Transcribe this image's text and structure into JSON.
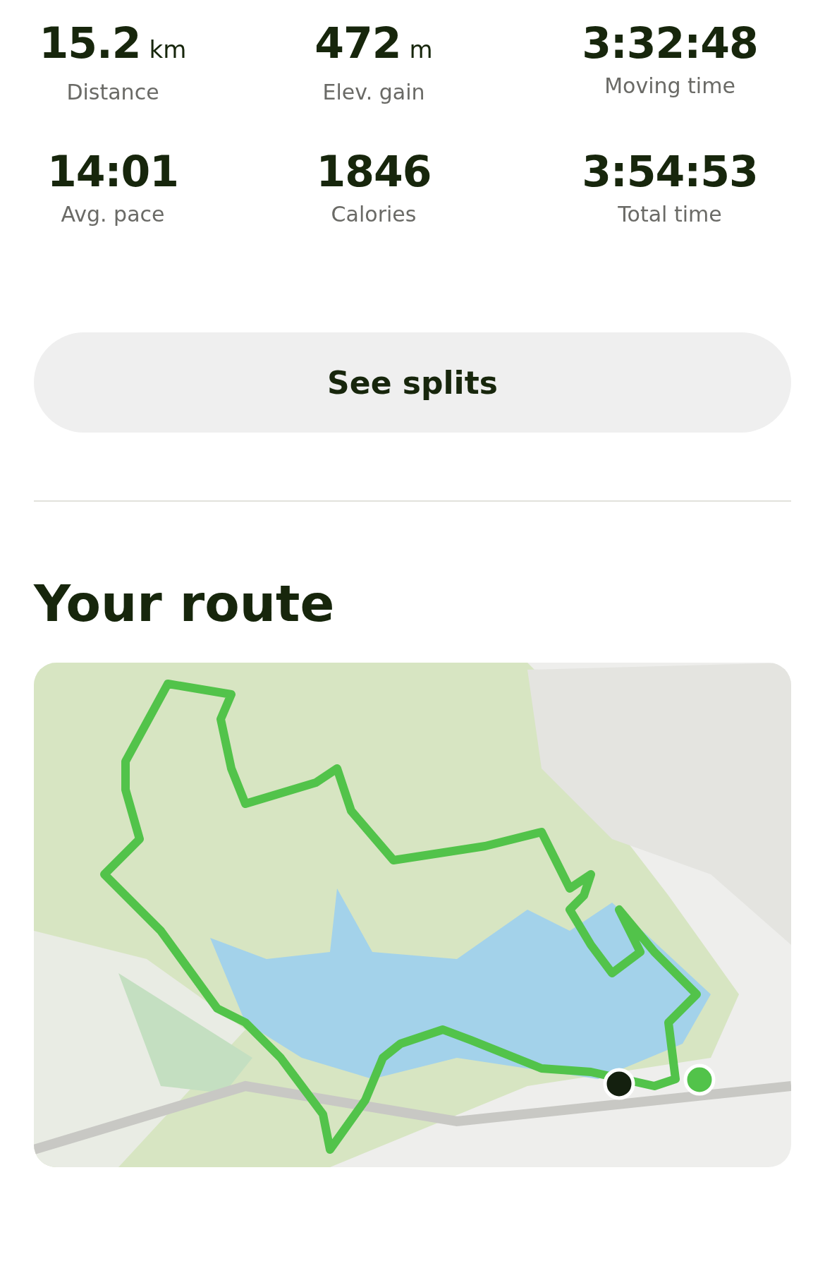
{
  "stats": [
    {
      "value": "15.2",
      "unit": "km",
      "label": "Distance"
    },
    {
      "value": "472",
      "unit": "m",
      "label": "Elev. gain"
    },
    {
      "value": "3:32:48",
      "label": "Moving time"
    },
    {
      "value": "14:01",
      "label": "Avg. pace"
    },
    {
      "value": "1846",
      "label": "Calories"
    },
    {
      "value": "3:54:53",
      "label": "Total time"
    }
  ],
  "splits_button": {
    "label": "See splits"
  },
  "route": {
    "heading": "Your route"
  }
}
